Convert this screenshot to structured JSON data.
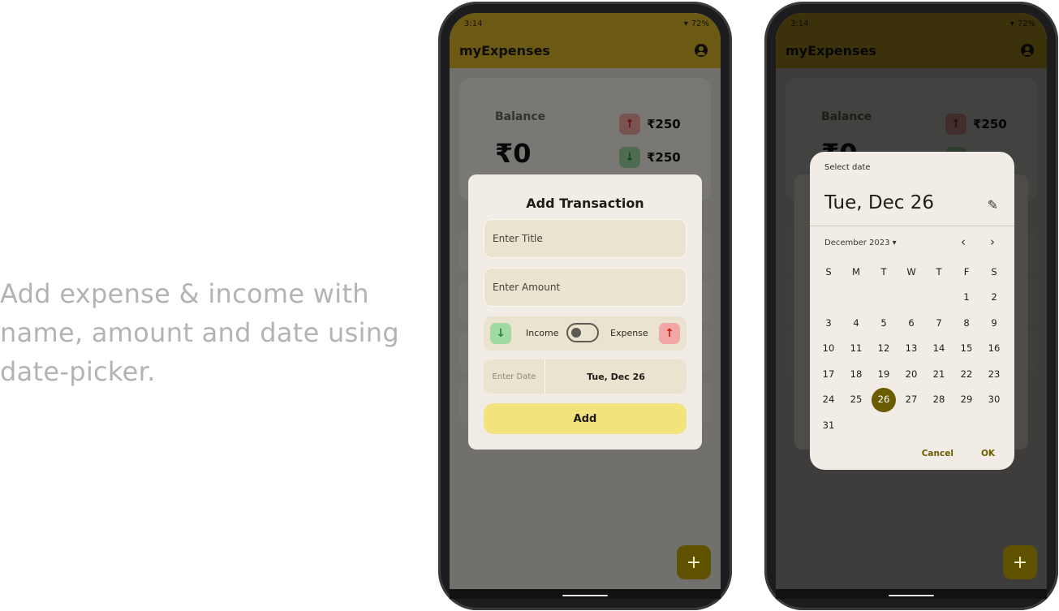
{
  "caption": "Add expense & income with name, amount and date using date-picker.",
  "status": {
    "time": "3:14",
    "battery": "72%"
  },
  "app": {
    "title": "myExpenses"
  },
  "balance": {
    "label": "Balance",
    "value": "₹0",
    "expense": "₹250",
    "income": "₹250"
  },
  "add_dialog": {
    "title": "Add Transaction",
    "title_placeholder": "Enter Title",
    "amount_placeholder": "Enter Amount",
    "income_label": "Income",
    "expense_label": "Expense",
    "date_placeholder": "Enter Date",
    "date_value": "Tue, Dec 26",
    "add_label": "Add"
  },
  "date_picker": {
    "header": "Select date",
    "selected": "Tue, Dec 26",
    "month": "December 2023",
    "weekdays": [
      "S",
      "M",
      "T",
      "W",
      "T",
      "F",
      "S"
    ],
    "weeks": [
      [
        "",
        "",
        "",
        "",
        "",
        "1",
        "2"
      ],
      [
        "3",
        "4",
        "5",
        "6",
        "7",
        "8",
        "9"
      ],
      [
        "10",
        "11",
        "12",
        "13",
        "14",
        "15",
        "16"
      ],
      [
        "17",
        "18",
        "19",
        "20",
        "21",
        "22",
        "23"
      ],
      [
        "24",
        "25",
        "26",
        "27",
        "28",
        "29",
        "30"
      ],
      [
        "31",
        "",
        "",
        "",
        "",
        "",
        ""
      ]
    ],
    "selected_day": "26",
    "cancel": "Cancel",
    "ok": "OK"
  },
  "icons": {
    "up": "arrow-up-icon",
    "down": "arrow-down-icon",
    "account": "account-circle-icon",
    "edit": "pencil-icon",
    "fab": "plus-icon"
  },
  "colors": {
    "accent": "#d8b326",
    "primary": "#6a5c00",
    "add_button": "#f2e37c"
  }
}
